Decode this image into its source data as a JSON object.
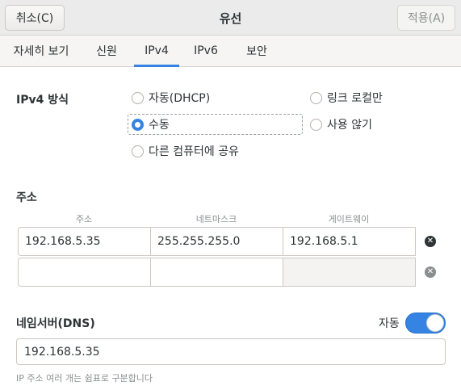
{
  "header": {
    "cancel_label": "취소(C)",
    "title": "유선",
    "apply_label": "적용(A)"
  },
  "tabs": [
    {
      "label": "자세히 보기",
      "active": false
    },
    {
      "label": "신원",
      "active": false
    },
    {
      "label": "IPv4",
      "active": true
    },
    {
      "label": "IPv6",
      "active": false
    },
    {
      "label": "보안",
      "active": false
    }
  ],
  "ipv4_method": {
    "label": "IPv4 방식",
    "options": [
      {
        "label": "자동(DHCP)",
        "checked": false
      },
      {
        "label": "링크 로컬만",
        "checked": false
      },
      {
        "label": "수동",
        "checked": true
      },
      {
        "label": "사용 않기",
        "checked": false
      },
      {
        "label": "다른 컴퓨터에 공유",
        "checked": false
      }
    ]
  },
  "addresses": {
    "label": "주소",
    "columns": [
      "주소",
      "네트마스크",
      "게이트웨이"
    ],
    "rows": [
      [
        "192.168.5.35",
        "255.255.255.0",
        "192.168.5.1"
      ],
      [
        "",
        "",
        ""
      ]
    ]
  },
  "dns": {
    "label": "네임서버(DNS)",
    "auto_label": "자동",
    "auto_enabled": true,
    "value": "192.168.5.35",
    "hint": "IP 주소 여러 개는 쉼표로 구분합니다"
  },
  "colors": {
    "accent": "#3584e4",
    "delete_active": "#2e3436",
    "delete_inactive": "#8b8e8f"
  }
}
